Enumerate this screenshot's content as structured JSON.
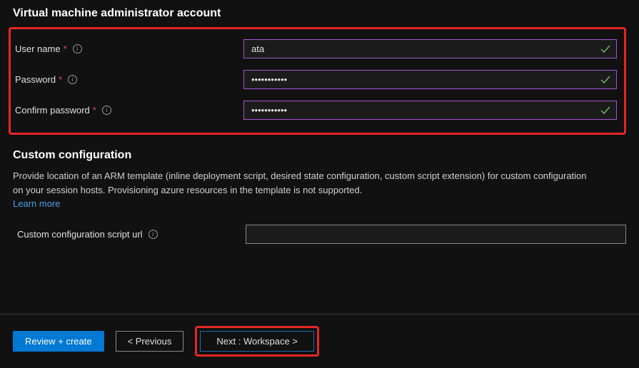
{
  "sections": {
    "admin_title": "Virtual machine administrator account",
    "custom_title": "Custom configuration",
    "custom_desc": "Provide location of an ARM template (inline deployment script, desired state configuration, custom script extension) for custom configuration on your session hosts. Provisioning azure resources in the template is not supported.",
    "learn_more": "Learn more"
  },
  "fields": {
    "username": {
      "label": "User name",
      "value": "ata"
    },
    "password": {
      "label": "Password",
      "value": "•••••••••••"
    },
    "confirm": {
      "label": "Confirm password",
      "value": "•••••••••••"
    },
    "script_url": {
      "label": "Custom configuration script url",
      "value": ""
    }
  },
  "footer": {
    "review": "Review + create",
    "previous": "<  Previous",
    "next": "Next : Workspace  >"
  }
}
